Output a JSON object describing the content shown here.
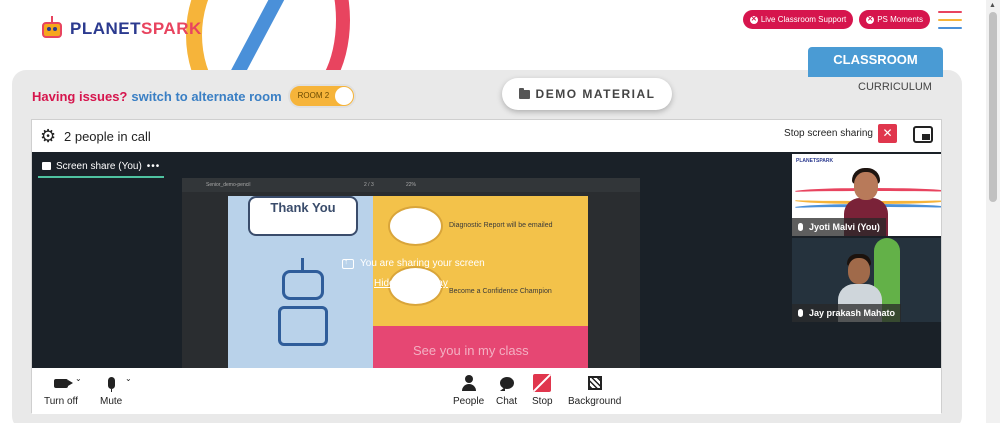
{
  "brand": {
    "logo_part1": "PLANET",
    "logo_part2": "SPARK"
  },
  "header": {
    "live_support_label": "Live Classroom Support",
    "moments_label": "PS Moments",
    "hamburger_colors": [
      "#e8445f",
      "#f6b43a",
      "#4a90d9"
    ]
  },
  "nav": {
    "classroom_tab": "CLASSROOM",
    "curriculum_tab": "CURRICULUM"
  },
  "issues": {
    "question": "Having issues?",
    "switch_text": "switch to alternate room",
    "room_toggle_label": "ROOM 2"
  },
  "demo_material_label": "DEMO MATERIAL",
  "call": {
    "people_count": "2 people in call",
    "stop_sharing_label": "Stop screen sharing",
    "share_tab_label": "Screen share (You)",
    "share_tab_menu": "•••",
    "overlay_message": "You are sharing your screen",
    "hide_overlay_label": "Hide this overlay",
    "document": {
      "file_name": "Senior_demo-pencil",
      "page_indicator": "2 / 3",
      "zoom": "22%",
      "thank_you": "Thank You",
      "line1": "Diagnostic Report will be emailed",
      "line2": "Become a Confidence Champion",
      "see_you": "See you in my class"
    },
    "participants": [
      {
        "name": "Jyoti Malvi (You)",
        "tile_logo": "PLANETSPARK"
      },
      {
        "name": "Jay prakash Mahato"
      }
    ]
  },
  "controls": {
    "camera": "Turn off",
    "mic": "Mute",
    "people": "People",
    "chat": "Chat",
    "stop": "Stop",
    "background": "Background"
  },
  "colors": {
    "accent_pink": "#d6154d",
    "classroom_blue": "#4a9bd4",
    "switch_blue": "#3a7fc4",
    "toggle_yellow": "#f6b43a",
    "stop_red": "#e0364d",
    "share_underline": "#4fc3a1"
  }
}
